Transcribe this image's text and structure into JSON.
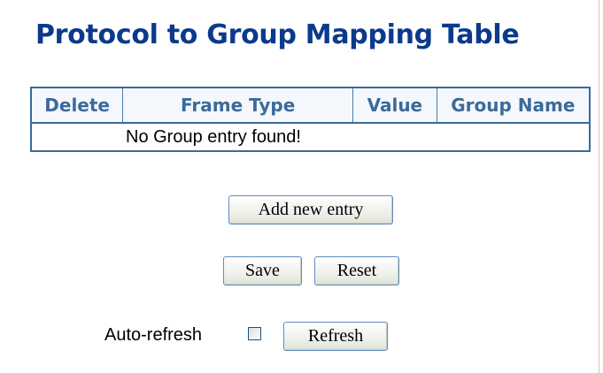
{
  "page": {
    "title": "Protocol to Group Mapping Table"
  },
  "table": {
    "headers": [
      "Delete",
      "Frame Type",
      "Value",
      "Group Name"
    ],
    "empty_message": "No Group entry found!"
  },
  "buttons": {
    "add_new_entry": "Add new entry",
    "save": "Save",
    "reset": "Reset",
    "refresh": "Refresh"
  },
  "auto_refresh": {
    "label": "Auto-refresh",
    "checked": false
  }
}
